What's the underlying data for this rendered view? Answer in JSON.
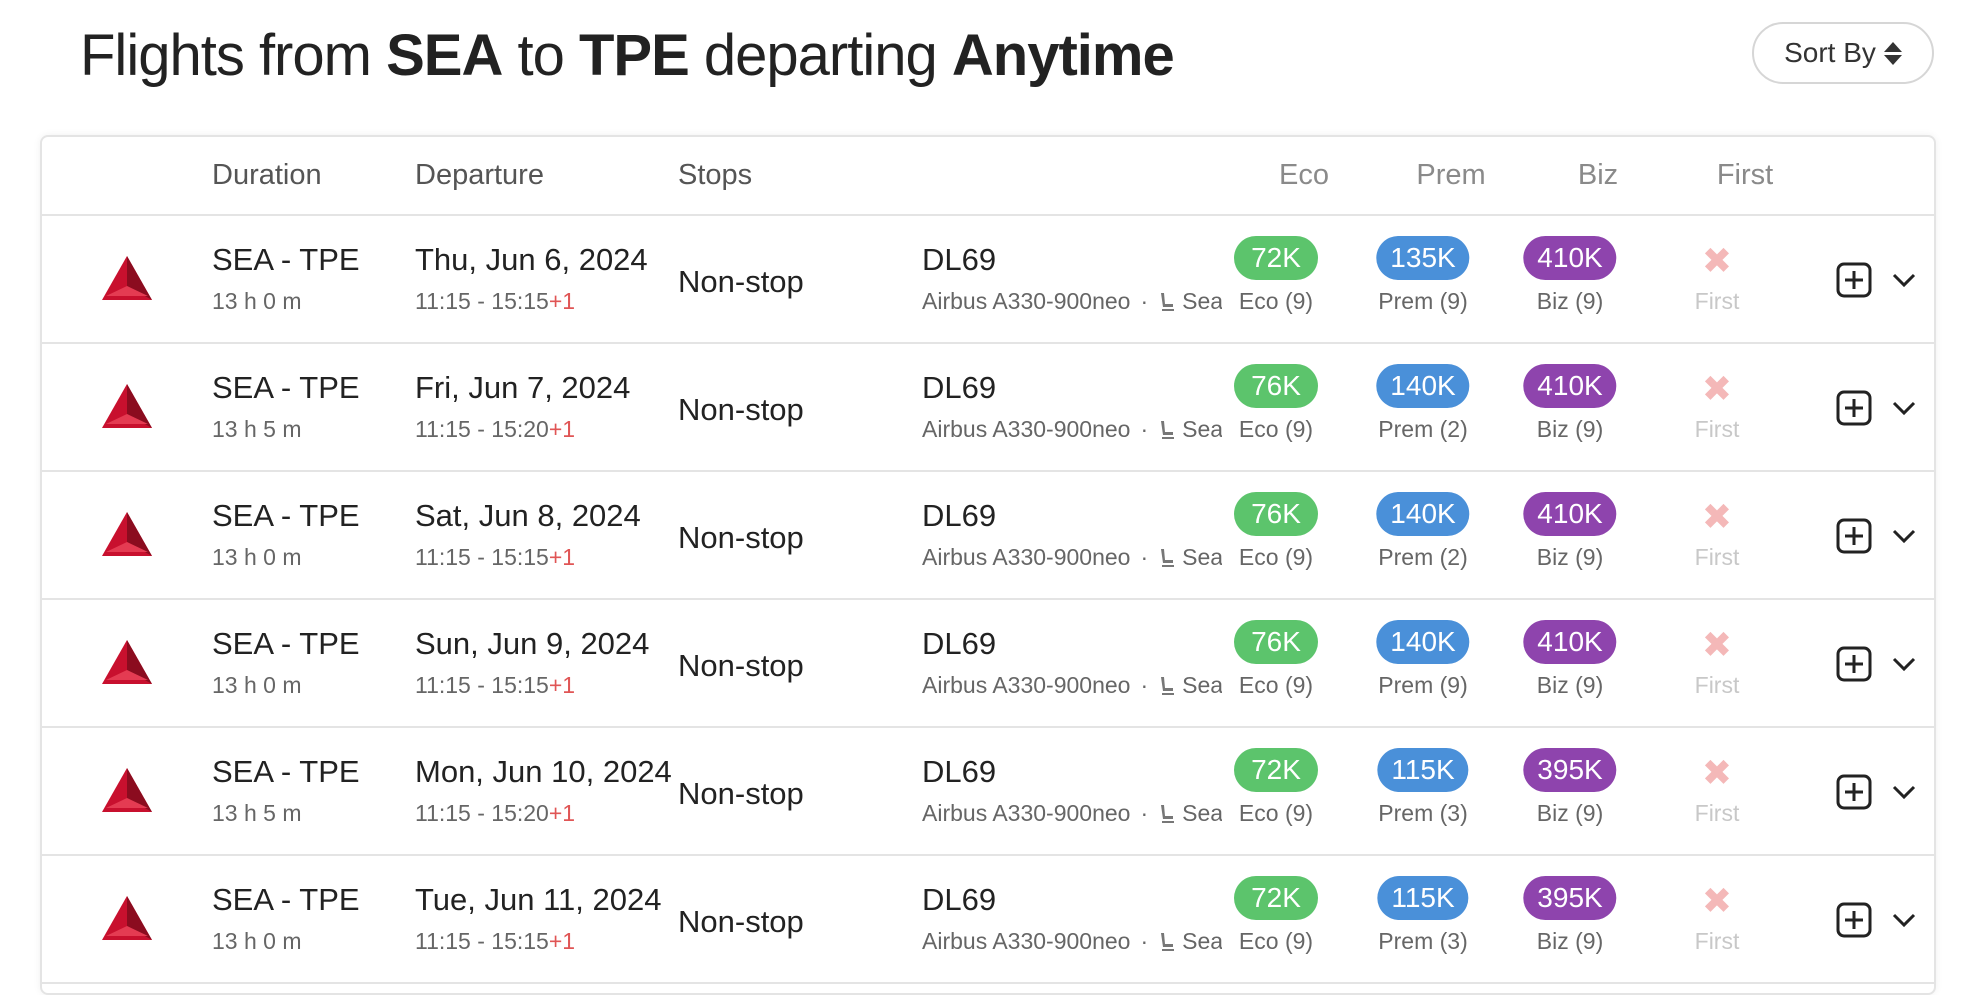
{
  "header": {
    "prefix": "Flights from",
    "origin": "SEA",
    "mid": "to",
    "destination": "TPE",
    "mid2": "departing",
    "when": "Anytime",
    "sort_label": "Sort By"
  },
  "columns": {
    "duration": "Duration",
    "departure": "Departure",
    "stops": "Stops",
    "eco": "Eco",
    "prem": "Prem",
    "biz": "Biz",
    "first": "First"
  },
  "colors": {
    "eco": "#5cc46c",
    "prem": "#4a90d9",
    "biz": "#8e44ad",
    "plus_day": "#e05555"
  },
  "rows": [
    {
      "route": "SEA - TPE",
      "duration": "13 h 0 m",
      "date": "Thu, Jun 6, 2024",
      "times": "11:15 - 15:15",
      "plus": "+1",
      "stops": "Non-stop",
      "flight": "DL69",
      "aircraft": "Airbus A330-900neo",
      "seat": "Sea",
      "eco": "72K",
      "eco_sub": "Eco (9)",
      "prem": "135K",
      "prem_sub": "Prem (9)",
      "biz": "410K",
      "biz_sub": "Biz (9)",
      "first_sub": "First"
    },
    {
      "route": "SEA - TPE",
      "duration": "13 h 5 m",
      "date": "Fri, Jun 7, 2024",
      "times": "11:15 - 15:20",
      "plus": "+1",
      "stops": "Non-stop",
      "flight": "DL69",
      "aircraft": "Airbus A330-900neo",
      "seat": "Sea",
      "eco": "76K",
      "eco_sub": "Eco (9)",
      "prem": "140K",
      "prem_sub": "Prem (2)",
      "biz": "410K",
      "biz_sub": "Biz (9)",
      "first_sub": "First"
    },
    {
      "route": "SEA - TPE",
      "duration": "13 h 0 m",
      "date": "Sat, Jun 8, 2024",
      "times": "11:15 - 15:15",
      "plus": "+1",
      "stops": "Non-stop",
      "flight": "DL69",
      "aircraft": "Airbus A330-900neo",
      "seat": "Sea",
      "eco": "76K",
      "eco_sub": "Eco (9)",
      "prem": "140K",
      "prem_sub": "Prem (2)",
      "biz": "410K",
      "biz_sub": "Biz (9)",
      "first_sub": "First"
    },
    {
      "route": "SEA - TPE",
      "duration": "13 h 0 m",
      "date": "Sun, Jun 9, 2024",
      "times": "11:15 - 15:15",
      "plus": "+1",
      "stops": "Non-stop",
      "flight": "DL69",
      "aircraft": "Airbus A330-900neo",
      "seat": "Sea",
      "eco": "76K",
      "eco_sub": "Eco (9)",
      "prem": "140K",
      "prem_sub": "Prem (9)",
      "biz": "410K",
      "biz_sub": "Biz (9)",
      "first_sub": "First"
    },
    {
      "route": "SEA - TPE",
      "duration": "13 h 5 m",
      "date": "Mon, Jun 10, 2024",
      "times": "11:15 - 15:20",
      "plus": "+1",
      "stops": "Non-stop",
      "flight": "DL69",
      "aircraft": "Airbus A330-900neo",
      "seat": "Sea",
      "eco": "72K",
      "eco_sub": "Eco (9)",
      "prem": "115K",
      "prem_sub": "Prem (3)",
      "biz": "395K",
      "biz_sub": "Biz (9)",
      "first_sub": "First"
    },
    {
      "route": "SEA - TPE",
      "duration": "13 h 0 m",
      "date": "Tue, Jun 11, 2024",
      "times": "11:15 - 15:15",
      "plus": "+1",
      "stops": "Non-stop",
      "flight": "DL69",
      "aircraft": "Airbus A330-900neo",
      "seat": "Sea",
      "eco": "72K",
      "eco_sub": "Eco (9)",
      "prem": "115K",
      "prem_sub": "Prem (3)",
      "biz": "395K",
      "biz_sub": "Biz (9)",
      "first_sub": "First"
    }
  ]
}
